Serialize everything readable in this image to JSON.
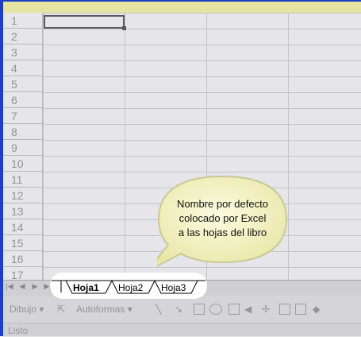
{
  "sheet": {
    "row_numbers": [
      "1",
      "2",
      "3",
      "4",
      "5",
      "6",
      "7",
      "8",
      "9",
      "10",
      "11",
      "12",
      "13",
      "14",
      "15",
      "16",
      "17"
    ]
  },
  "tabs": {
    "nav": [
      "|◀",
      "◀",
      "▶",
      "▶|"
    ],
    "items": [
      "Hoja1",
      "Hoja2",
      "Hoja3"
    ],
    "active": "Hoja1"
  },
  "drawing_toolbar": {
    "draw_label": "Dibujo ▾",
    "autoshapes_label": "Autoformas ▾"
  },
  "status": {
    "text": "Listo"
  },
  "callout": {
    "text": "Nombre por defecto\ncolocado por Excel\na las hojas del libro",
    "fill": "#f3f2c0",
    "border": "#c9c995"
  }
}
